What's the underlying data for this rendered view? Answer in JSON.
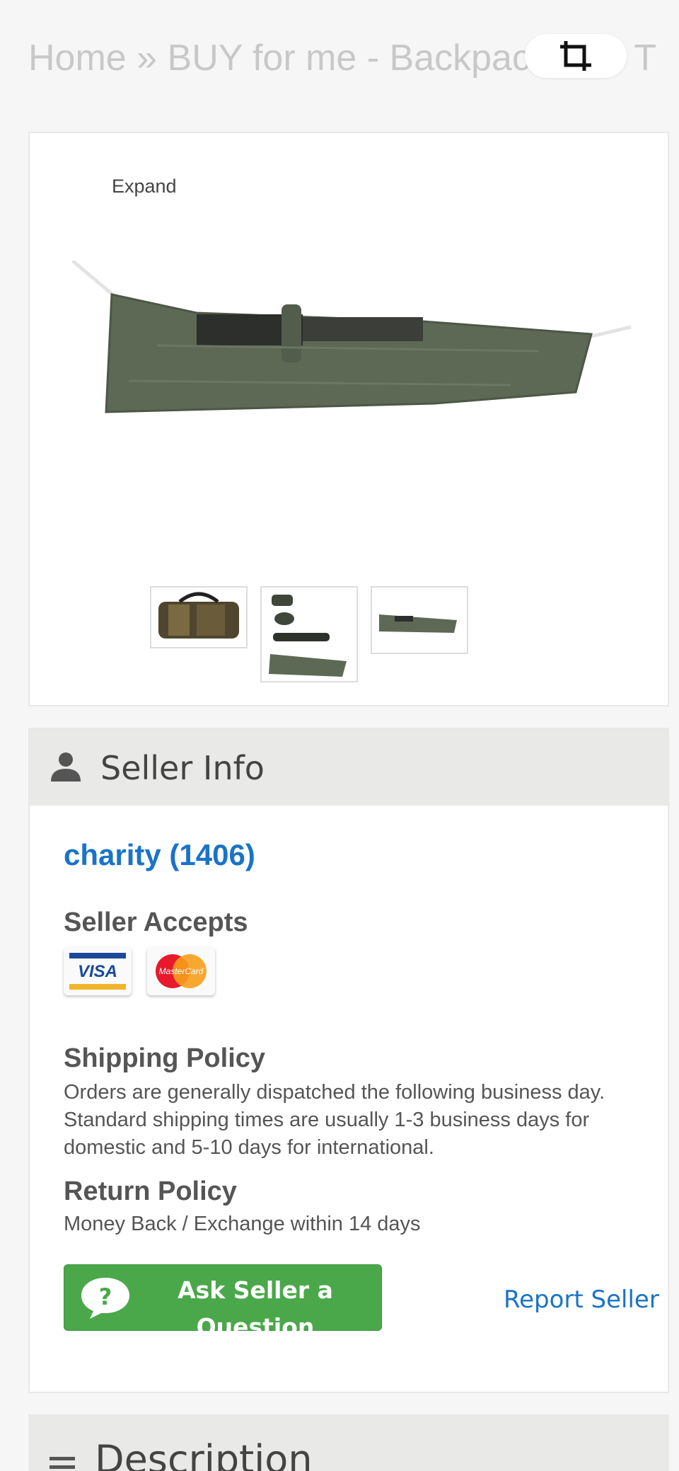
{
  "breadcrumb": {
    "text": "Home » BUY for me - Backpac…d™ T"
  },
  "product": {
    "expand_label": "Expand",
    "thumbnails": [
      "duffel-bag-thumbnail",
      "components-thumbnail",
      "sleeping-bag-thumbnail"
    ]
  },
  "seller_info": {
    "header": "Seller Info",
    "seller_name": "charity (1406)",
    "accepts_label": "Seller Accepts",
    "payment_methods": [
      "VISA",
      "MasterCard"
    ],
    "shipping_label": "Shipping Policy",
    "shipping_text": "Orders are generally dispatched the following business day. Standard shipping times are usually 1-3 business days for domestic and 5-10 days for international.",
    "return_label": "Return Policy",
    "return_text": "Money Back / Exchange within 14 days",
    "ask_button": "Ask Seller a Question",
    "report_link": "Report Seller"
  },
  "description": {
    "header": "Description"
  },
  "colors": {
    "link": "#1a73c8",
    "button_green": "#4aa84a",
    "header_bg": "#e9e9e7"
  }
}
